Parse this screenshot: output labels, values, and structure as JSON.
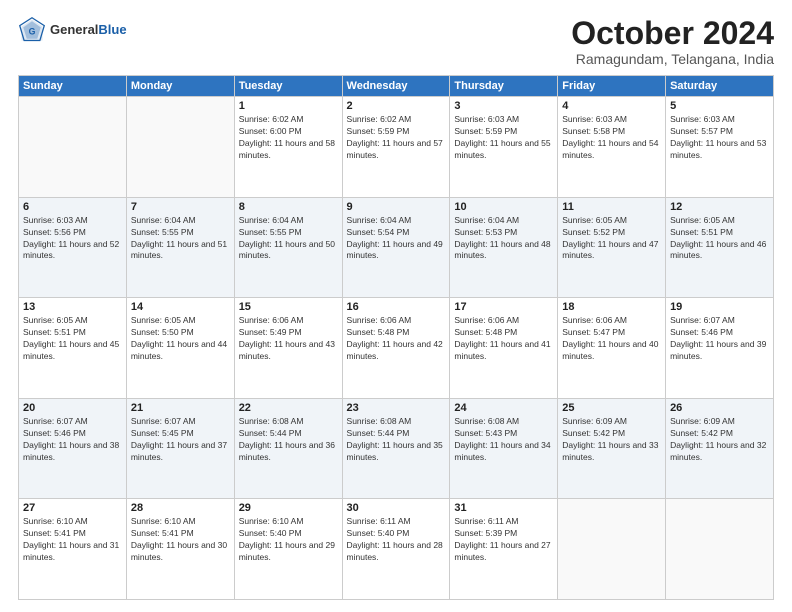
{
  "header": {
    "logo": {
      "general": "General",
      "blue": "Blue"
    },
    "title": "October 2024",
    "subtitle": "Ramagundam, Telangana, India"
  },
  "weekdays": [
    "Sunday",
    "Monday",
    "Tuesday",
    "Wednesday",
    "Thursday",
    "Friday",
    "Saturday"
  ],
  "weeks": [
    [
      {
        "day": "",
        "content": ""
      },
      {
        "day": "",
        "content": ""
      },
      {
        "day": "1",
        "content": "Sunrise: 6:02 AM\nSunset: 6:00 PM\nDaylight: 11 hours and 58 minutes."
      },
      {
        "day": "2",
        "content": "Sunrise: 6:02 AM\nSunset: 5:59 PM\nDaylight: 11 hours and 57 minutes."
      },
      {
        "day": "3",
        "content": "Sunrise: 6:03 AM\nSunset: 5:59 PM\nDaylight: 11 hours and 55 minutes."
      },
      {
        "day": "4",
        "content": "Sunrise: 6:03 AM\nSunset: 5:58 PM\nDaylight: 11 hours and 54 minutes."
      },
      {
        "day": "5",
        "content": "Sunrise: 6:03 AM\nSunset: 5:57 PM\nDaylight: 11 hours and 53 minutes."
      }
    ],
    [
      {
        "day": "6",
        "content": "Sunrise: 6:03 AM\nSunset: 5:56 PM\nDaylight: 11 hours and 52 minutes."
      },
      {
        "day": "7",
        "content": "Sunrise: 6:04 AM\nSunset: 5:55 PM\nDaylight: 11 hours and 51 minutes."
      },
      {
        "day": "8",
        "content": "Sunrise: 6:04 AM\nSunset: 5:55 PM\nDaylight: 11 hours and 50 minutes."
      },
      {
        "day": "9",
        "content": "Sunrise: 6:04 AM\nSunset: 5:54 PM\nDaylight: 11 hours and 49 minutes."
      },
      {
        "day": "10",
        "content": "Sunrise: 6:04 AM\nSunset: 5:53 PM\nDaylight: 11 hours and 48 minutes."
      },
      {
        "day": "11",
        "content": "Sunrise: 6:05 AM\nSunset: 5:52 PM\nDaylight: 11 hours and 47 minutes."
      },
      {
        "day": "12",
        "content": "Sunrise: 6:05 AM\nSunset: 5:51 PM\nDaylight: 11 hours and 46 minutes."
      }
    ],
    [
      {
        "day": "13",
        "content": "Sunrise: 6:05 AM\nSunset: 5:51 PM\nDaylight: 11 hours and 45 minutes."
      },
      {
        "day": "14",
        "content": "Sunrise: 6:05 AM\nSunset: 5:50 PM\nDaylight: 11 hours and 44 minutes."
      },
      {
        "day": "15",
        "content": "Sunrise: 6:06 AM\nSunset: 5:49 PM\nDaylight: 11 hours and 43 minutes."
      },
      {
        "day": "16",
        "content": "Sunrise: 6:06 AM\nSunset: 5:48 PM\nDaylight: 11 hours and 42 minutes."
      },
      {
        "day": "17",
        "content": "Sunrise: 6:06 AM\nSunset: 5:48 PM\nDaylight: 11 hours and 41 minutes."
      },
      {
        "day": "18",
        "content": "Sunrise: 6:06 AM\nSunset: 5:47 PM\nDaylight: 11 hours and 40 minutes."
      },
      {
        "day": "19",
        "content": "Sunrise: 6:07 AM\nSunset: 5:46 PM\nDaylight: 11 hours and 39 minutes."
      }
    ],
    [
      {
        "day": "20",
        "content": "Sunrise: 6:07 AM\nSunset: 5:46 PM\nDaylight: 11 hours and 38 minutes."
      },
      {
        "day": "21",
        "content": "Sunrise: 6:07 AM\nSunset: 5:45 PM\nDaylight: 11 hours and 37 minutes."
      },
      {
        "day": "22",
        "content": "Sunrise: 6:08 AM\nSunset: 5:44 PM\nDaylight: 11 hours and 36 minutes."
      },
      {
        "day": "23",
        "content": "Sunrise: 6:08 AM\nSunset: 5:44 PM\nDaylight: 11 hours and 35 minutes."
      },
      {
        "day": "24",
        "content": "Sunrise: 6:08 AM\nSunset: 5:43 PM\nDaylight: 11 hours and 34 minutes."
      },
      {
        "day": "25",
        "content": "Sunrise: 6:09 AM\nSunset: 5:42 PM\nDaylight: 11 hours and 33 minutes."
      },
      {
        "day": "26",
        "content": "Sunrise: 6:09 AM\nSunset: 5:42 PM\nDaylight: 11 hours and 32 minutes."
      }
    ],
    [
      {
        "day": "27",
        "content": "Sunrise: 6:10 AM\nSunset: 5:41 PM\nDaylight: 11 hours and 31 minutes."
      },
      {
        "day": "28",
        "content": "Sunrise: 6:10 AM\nSunset: 5:41 PM\nDaylight: 11 hours and 30 minutes."
      },
      {
        "day": "29",
        "content": "Sunrise: 6:10 AM\nSunset: 5:40 PM\nDaylight: 11 hours and 29 minutes."
      },
      {
        "day": "30",
        "content": "Sunrise: 6:11 AM\nSunset: 5:40 PM\nDaylight: 11 hours and 28 minutes."
      },
      {
        "day": "31",
        "content": "Sunrise: 6:11 AM\nSunset: 5:39 PM\nDaylight: 11 hours and 27 minutes."
      },
      {
        "day": "",
        "content": ""
      },
      {
        "day": "",
        "content": ""
      }
    ]
  ]
}
